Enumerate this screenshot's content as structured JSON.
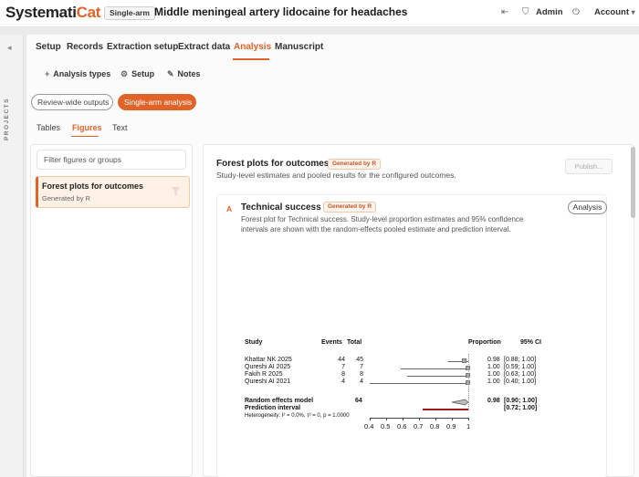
{
  "header": {
    "logo_main": "Systemati",
    "logo_accent": "Cat",
    "mode_badge": "Single-arm",
    "project_title": "Middle meningeal artery lidocaine for headaches",
    "back_icon": "⇤",
    "admin_label": "Admin",
    "account_label": "Account",
    "chevron": "▾",
    "shield_icon": "⛉",
    "power_icon": "⏻"
  },
  "rail": {
    "label": "PROJECTS",
    "collapse_icon": "◂"
  },
  "tabs": [
    {
      "label": "Setup"
    },
    {
      "label": "Records"
    },
    {
      "label": "Extraction setup"
    },
    {
      "label": "Extract data"
    },
    {
      "label": "Analysis"
    },
    {
      "label": "Manuscript"
    }
  ],
  "subtools": [
    {
      "icon": "+",
      "label": "Analysis types"
    },
    {
      "icon": "⚙",
      "label": "Setup"
    },
    {
      "icon": "✎",
      "label": "Notes"
    }
  ],
  "segments": {
    "review": "Review-wide outputs",
    "single": "Single-arm analysis"
  },
  "view_tabs": [
    "Tables",
    "Figures",
    "Text"
  ],
  "sidebar": {
    "filter_placeholder": "Filter figures or groups",
    "item_title": "Forest plots for outcomes",
    "item_sub": "Generated by R"
  },
  "main": {
    "title": "Forest plots for outcomes",
    "badge": "Generated by R",
    "subtitle": "Study-level estimates and pooled results for the configured outcomes.",
    "publish_label": "Publish..."
  },
  "figure": {
    "letter": "A",
    "title": "Technical success",
    "badge": "Generated by R",
    "description": "Forest plot for Technical success. Study-level proportion estimates and 95% confidence intervals are shown with the random-effects pooled estimate and prediction interval.",
    "analysis_button": "Analysis"
  },
  "chart_data": {
    "type": "table",
    "columns": [
      "Study",
      "Events",
      "Total",
      "Proportion",
      "95% CI"
    ],
    "studies": [
      {
        "study": "Khattar NK 2025",
        "events": "44",
        "total": "45",
        "proportion": "0.98",
        "ci": "[0.88; 1.00]",
        "est": 0.98,
        "lo": 0.88,
        "hi": 1.0
      },
      {
        "study": "Qureshi AI 2025",
        "events": "7",
        "total": "7",
        "proportion": "1.00",
        "ci": "[0.59; 1.00]",
        "est": 1.0,
        "lo": 0.59,
        "hi": 1.0
      },
      {
        "study": "Fakih R 2025",
        "events": "8",
        "total": "8",
        "proportion": "1.00",
        "ci": "[0.63; 1.00]",
        "est": 1.0,
        "lo": 0.63,
        "hi": 1.0
      },
      {
        "study": "Qureshi AI 2021",
        "events": "4",
        "total": "4",
        "proportion": "1.00",
        "ci": "[0.40; 1.00]",
        "est": 1.0,
        "lo": 0.4,
        "hi": 1.0
      }
    ],
    "pooled": {
      "label": "Random effects model",
      "total": "64",
      "proportion": "0.98",
      "ci": "[0.90; 1.00]",
      "est": 0.98,
      "lo": 0.9,
      "hi": 1.0
    },
    "prediction": {
      "label": "Prediction interval",
      "ci": "[0.72; 1.00]",
      "lo": 0.72,
      "hi": 1.0
    },
    "heterogeneity": "Heterogeneity: I² = 0.0%, τ² = 0, p = 1.0000",
    "x_ticks": [
      "0.4",
      "0.5",
      "0.6",
      "0.7",
      "0.8",
      "0.9",
      "1"
    ],
    "xlim": [
      0.4,
      1.0
    ]
  }
}
